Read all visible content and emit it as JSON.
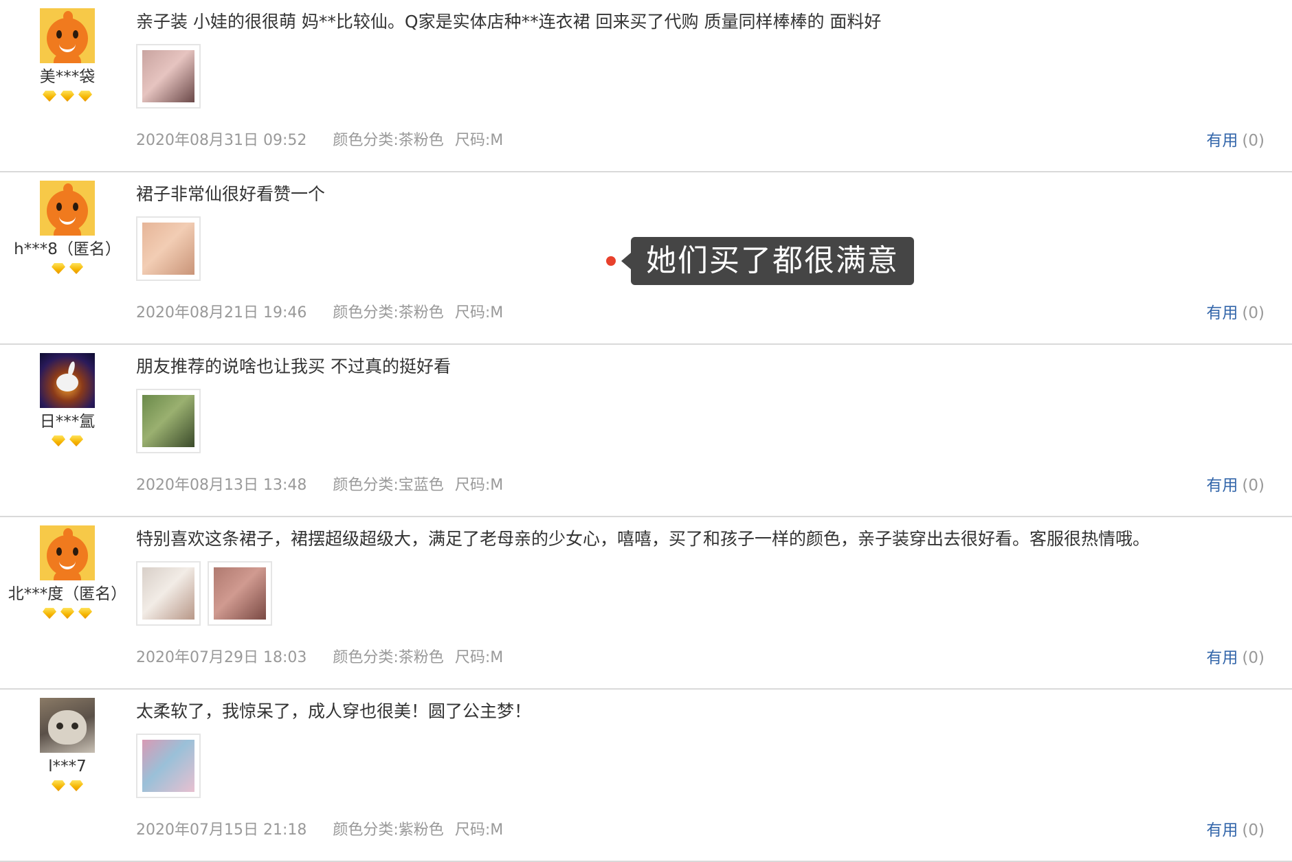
{
  "reviews": [
    {
      "username": "美***袋",
      "avatar": "orange-mascot-avatar",
      "gem_count": 3,
      "text": "亲子装 小娃的很很萌 妈**比较仙。Q家是实体店种**连衣裙 回来买了代购 质量同样棒棒的 面料好",
      "photos": [
        {
          "desc": "woman in pink dress",
          "colors": [
            "#c9a4a0",
            "#e6c4c0",
            "#6a4848"
          ]
        }
      ],
      "date": "2020年08月31日 09:52",
      "color_label": "颜色分类:",
      "color_value": "茶粉色",
      "size_label": "尺码:",
      "size_value": "M",
      "useful_label": "有用",
      "useful_count": "(0)"
    },
    {
      "username": "h***8（匿名）",
      "avatar": "orange-mascot-avatar",
      "gem_count": 2,
      "text": "裙子非常仙很好看赞一个",
      "photos": [
        {
          "desc": "peach tulle skirt",
          "colors": [
            "#e6b598",
            "#f2cdb4",
            "#c99478"
          ]
        }
      ],
      "date": "2020年08月21日 19:46",
      "color_label": "颜色分类:",
      "color_value": "茶粉色",
      "size_label": "尺码:",
      "size_value": "M",
      "useful_label": "有用",
      "useful_count": "(0)"
    },
    {
      "username": "日***氲",
      "avatar": "bunny-sunset-avatar",
      "gem_count": 2,
      "text": "朋友推荐的说啥也让我买 不过真的挺好看",
      "photos": [
        {
          "desc": "outdoor photo with trees",
          "colors": [
            "#6a8a4a",
            "#9ab070",
            "#3a4a2a"
          ]
        }
      ],
      "date": "2020年08月13日 13:48",
      "color_label": "颜色分类:",
      "color_value": "宝蓝色",
      "size_label": "尺码:",
      "size_value": "M",
      "useful_label": "有用",
      "useful_count": "(0)"
    },
    {
      "username": "北***度（匿名）",
      "avatar": "orange-mascot-avatar",
      "gem_count": 3,
      "text": "特别喜欢这条裙子，裙摆超级超级大，满足了老母亲的少女心，嘻嘻，买了和孩子一样的颜色，亲子装穿出去很好看。客服很热情哦。",
      "photos": [
        {
          "desc": "cup product photo",
          "colors": [
            "#d8cfc8",
            "#f2ece6",
            "#b89888"
          ]
        },
        {
          "desc": "fabric close-up",
          "colors": [
            "#b07a70",
            "#d09a90",
            "#7a4a44"
          ]
        }
      ],
      "date": "2020年07月29日 18:03",
      "color_label": "颜色分类:",
      "color_value": "茶粉色",
      "size_label": "尺码:",
      "size_value": "M",
      "useful_label": "有用",
      "useful_count": "(0)"
    },
    {
      "username": "l***7",
      "avatar": "cat-photo-avatar",
      "gem_count": 2,
      "text": "太柔软了，我惊呆了，成人穿也很美！圆了公主梦！",
      "photos": [
        {
          "desc": "pink floral dress photo",
          "colors": [
            "#d89ab4",
            "#9ac0d8",
            "#e8c0d0"
          ]
        }
      ],
      "date": "2020年07月15日 21:18",
      "color_label": "颜色分类:",
      "color_value": "紫粉色",
      "size_label": "尺码:",
      "size_value": "M",
      "useful_label": "有用",
      "useful_count": "(0)"
    }
  ],
  "tooltip": {
    "text": "她们买了都很满意",
    "dot_color": "#e8412c",
    "bg_color": "#454545"
  },
  "colors": {
    "link_blue": "#3366aa",
    "meta_gray": "#999999",
    "divider": "#d9d9d9"
  }
}
